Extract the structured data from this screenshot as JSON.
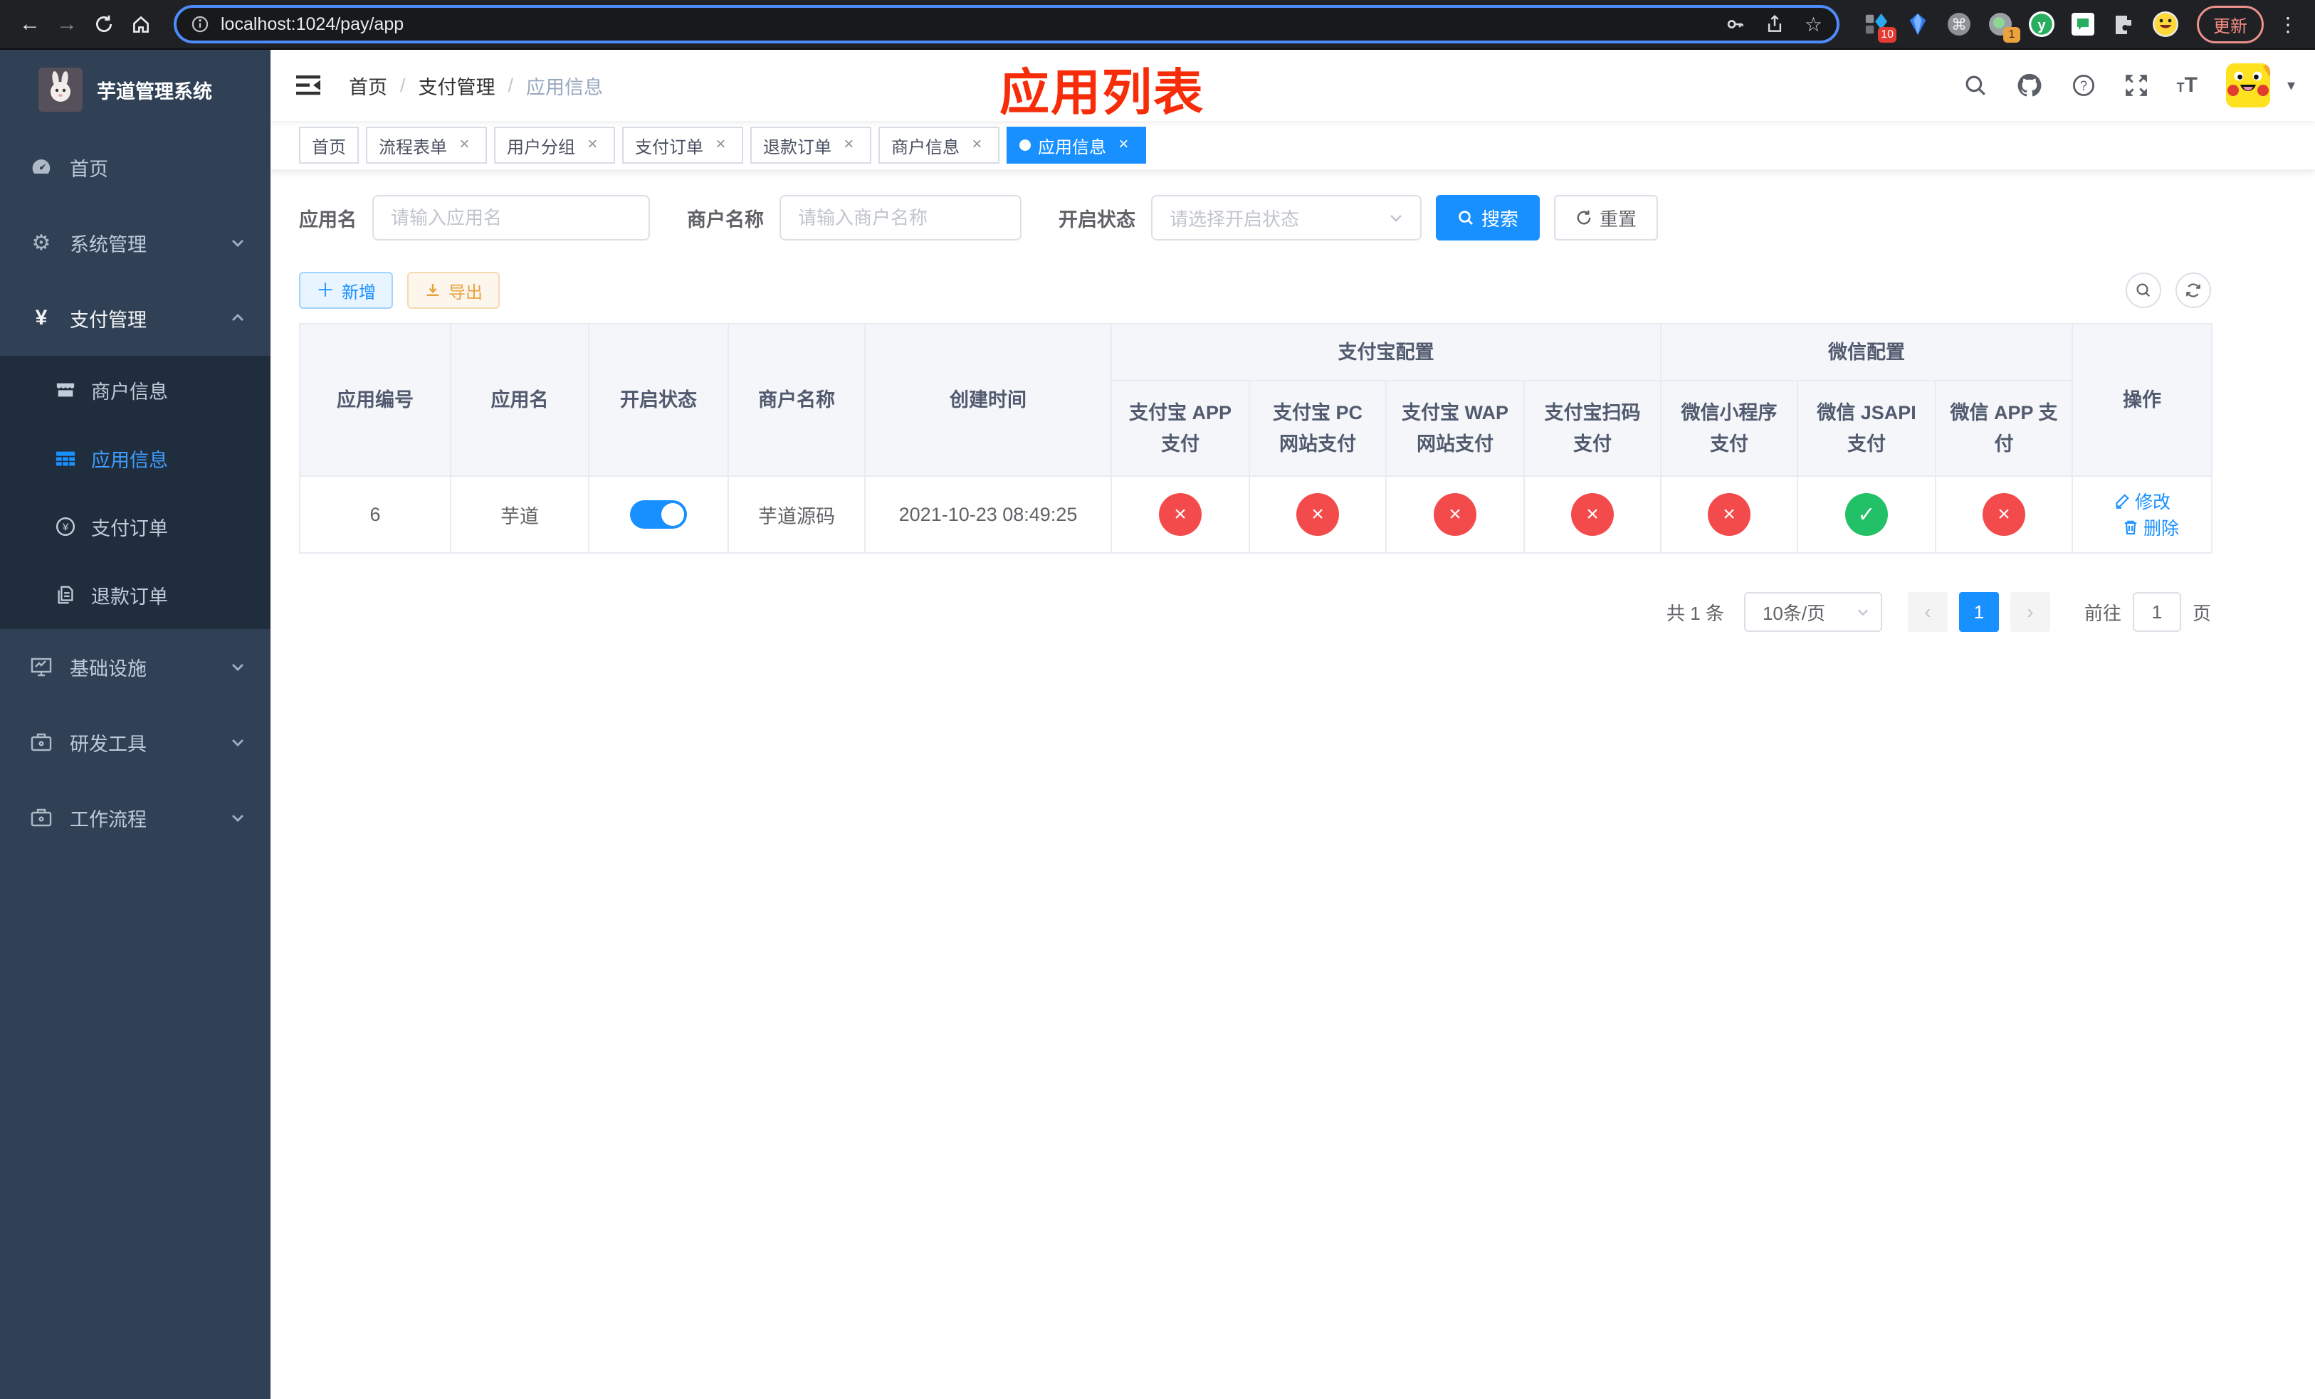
{
  "browser": {
    "url": "localhost:1024/pay/app",
    "update_label": "更新",
    "extensions": [
      {
        "name": "grid-diamond-extension-icon",
        "badge": "10"
      },
      {
        "name": "gem-extension-icon",
        "badge": ""
      },
      {
        "name": "command-extension-icon",
        "badge": ""
      },
      {
        "name": "record-extension-icon",
        "badge": "1"
      },
      {
        "name": "y-extension-icon",
        "badge": ""
      },
      {
        "name": "chat-extension-icon",
        "badge": ""
      },
      {
        "name": "puzzle-extension-icon",
        "badge": ""
      },
      {
        "name": "emoji-extension-icon",
        "badge": ""
      }
    ]
  },
  "sidebar": {
    "logo_title": "芋道管理系统",
    "menu": [
      {
        "label": "首页",
        "icon": "dashboard-icon"
      },
      {
        "label": "系统管理",
        "icon": "gear-icon"
      },
      {
        "label": "支付管理",
        "icon": "yen-icon",
        "children": [
          {
            "label": "商户信息",
            "icon": "shop-icon"
          },
          {
            "label": "应用信息",
            "icon": "grid-icon"
          },
          {
            "label": "支付订单",
            "icon": "yen-circle-icon"
          },
          {
            "label": "退款订单",
            "icon": "document-icon"
          }
        ]
      },
      {
        "label": "基础设施",
        "icon": "monitor-icon"
      },
      {
        "label": "研发工具",
        "icon": "briefcase-icon"
      },
      {
        "label": "工作流程",
        "icon": "briefcase-icon"
      }
    ]
  },
  "navbar": {
    "breadcrumb": [
      "首页",
      "支付管理",
      "应用信息"
    ],
    "annotation": "应用列表"
  },
  "tabs": [
    {
      "label": "首页",
      "closable": false,
      "active": false
    },
    {
      "label": "流程表单",
      "closable": true,
      "active": false
    },
    {
      "label": "用户分组",
      "closable": true,
      "active": false
    },
    {
      "label": "支付订单",
      "closable": true,
      "active": false
    },
    {
      "label": "退款订单",
      "closable": true,
      "active": false
    },
    {
      "label": "商户信息",
      "closable": true,
      "active": false
    },
    {
      "label": "应用信息",
      "closable": true,
      "active": true
    }
  ],
  "filters": {
    "app_name_label": "应用名",
    "app_name_placeholder": "请输入应用名",
    "merchant_label": "商户名称",
    "merchant_placeholder": "请输入商户名称",
    "status_label": "开启状态",
    "status_placeholder": "请选择开启状态",
    "search_label": "搜索",
    "reset_label": "重置"
  },
  "toolbar": {
    "add_label": "新增",
    "export_label": "导出"
  },
  "table": {
    "columns_flat": [
      "应用编号",
      "应用名",
      "开启状态",
      "商户名称",
      "创建时间"
    ],
    "group_alipay": {
      "label": "支付宝配置",
      "children": [
        "支付宝 APP 支付",
        "支付宝 PC 网站支付",
        "支付宝 WAP 网站支付",
        "支付宝扫码支付"
      ]
    },
    "group_wechat": {
      "label": "微信配置",
      "children": [
        "微信小程序支付",
        "微信 JSAPI 支付",
        "微信 APP 支付"
      ]
    },
    "op_label": "操作",
    "rows": [
      {
        "id": "6",
        "app_name": "芋道",
        "enabled": true,
        "merchant": "芋道源码",
        "created": "2021-10-23 08:49:25",
        "statuses": [
          false,
          false,
          false,
          false,
          false,
          true,
          false
        ],
        "edit_label": "修改",
        "delete_label": "删除"
      }
    ]
  },
  "pagination": {
    "total_text": "共 1 条",
    "page_size": "10条/页",
    "current_page": "1",
    "goto_label": "前往",
    "goto_value": "1",
    "unit": "页"
  },
  "colors": {
    "accent": "#1890ff",
    "sidebar_bg": "#304156",
    "submenu_bg": "#1f2d3d",
    "active_text": "#3f9eff",
    "danger": "#f34b4b",
    "success": "#22c168",
    "annotation": "#f72c08"
  }
}
